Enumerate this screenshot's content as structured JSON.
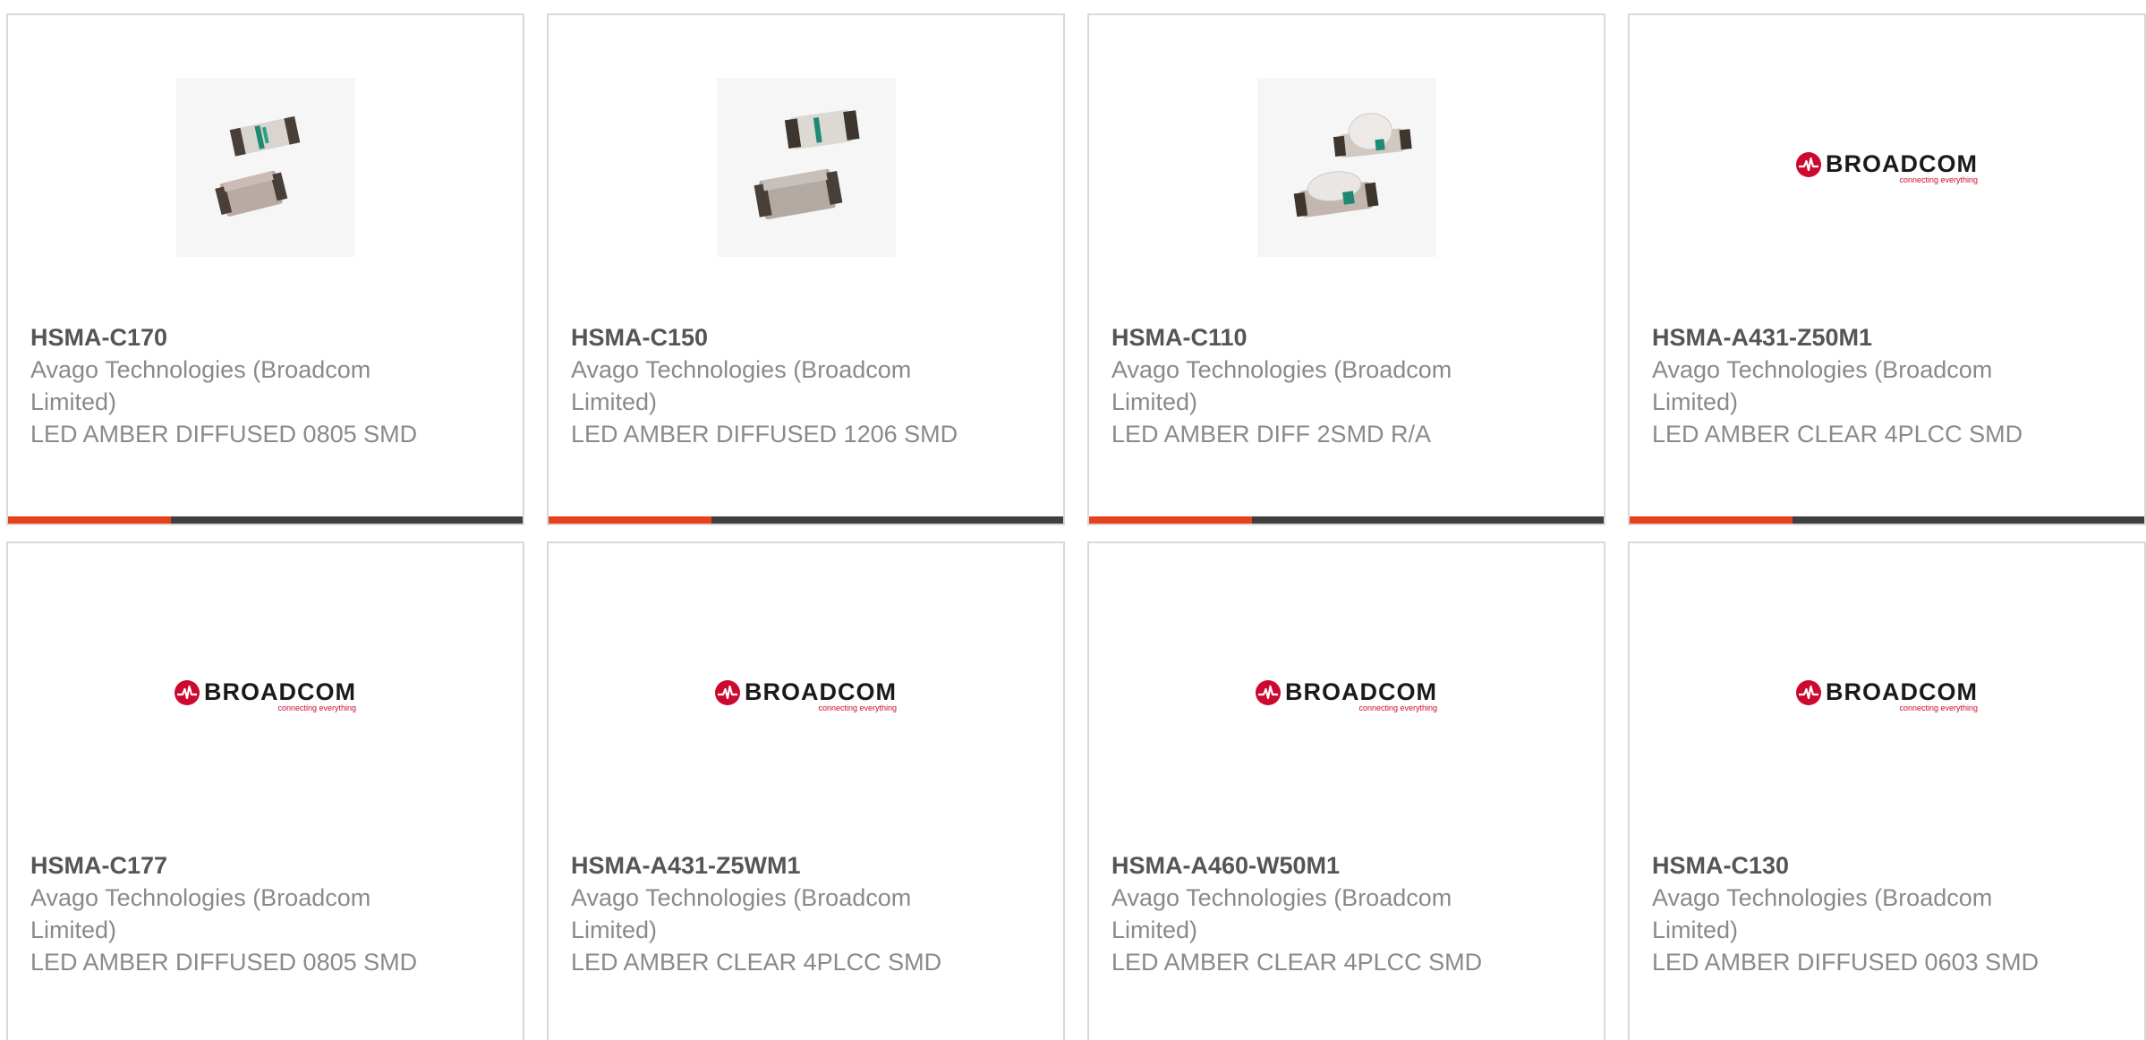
{
  "colors": {
    "accent": "#e8401c",
    "bar": "#3f3f3f",
    "border": "#d9d9d9",
    "part_number": "#555555",
    "text": "#8a8a8a",
    "brand_red": "#cc092f"
  },
  "products": [
    {
      "part_number": "HSMA-C170",
      "manufacturer": "Avago Technologies (Broadcom Limited)",
      "description": "LED AMBER DIFFUSED 0805 SMD",
      "image": "led-photo-two-chip"
    },
    {
      "part_number": "HSMA-C150",
      "manufacturer": "Avago Technologies (Broadcom Limited)",
      "description": "LED AMBER DIFFUSED 1206 SMD",
      "image": "led-photo-two-chip"
    },
    {
      "part_number": "HSMA-C110",
      "manufacturer": "Avago Technologies (Broadcom Limited)",
      "description": "LED AMBER DIFF 2SMD R/A",
      "image": "led-photo-dome"
    },
    {
      "part_number": "HSMA-A431-Z50M1",
      "manufacturer": "Avago Technologies (Broadcom Limited)",
      "description": "LED AMBER CLEAR 4PLCC SMD",
      "image": "broadcom-logo"
    },
    {
      "part_number": "HSMA-C177",
      "manufacturer": "Avago Technologies (Broadcom Limited)",
      "description": "LED AMBER DIFFUSED 0805 SMD",
      "image": "broadcom-logo"
    },
    {
      "part_number": "HSMA-A431-Z5WM1",
      "manufacturer": "Avago Technologies (Broadcom Limited)",
      "description": "LED AMBER CLEAR 4PLCC SMD",
      "image": "broadcom-logo"
    },
    {
      "part_number": "HSMA-A460-W50M1",
      "manufacturer": "Avago Technologies (Broadcom Limited)",
      "description": "LED AMBER CLEAR 4PLCC SMD",
      "image": "broadcom-logo"
    },
    {
      "part_number": "HSMA-C130",
      "manufacturer": "Avago Technologies (Broadcom Limited)",
      "description": "LED AMBER DIFFUSED 0603 SMD",
      "image": "broadcom-logo"
    }
  ],
  "logo": {
    "name": "BROADCOM",
    "tagline": "connecting everything"
  }
}
